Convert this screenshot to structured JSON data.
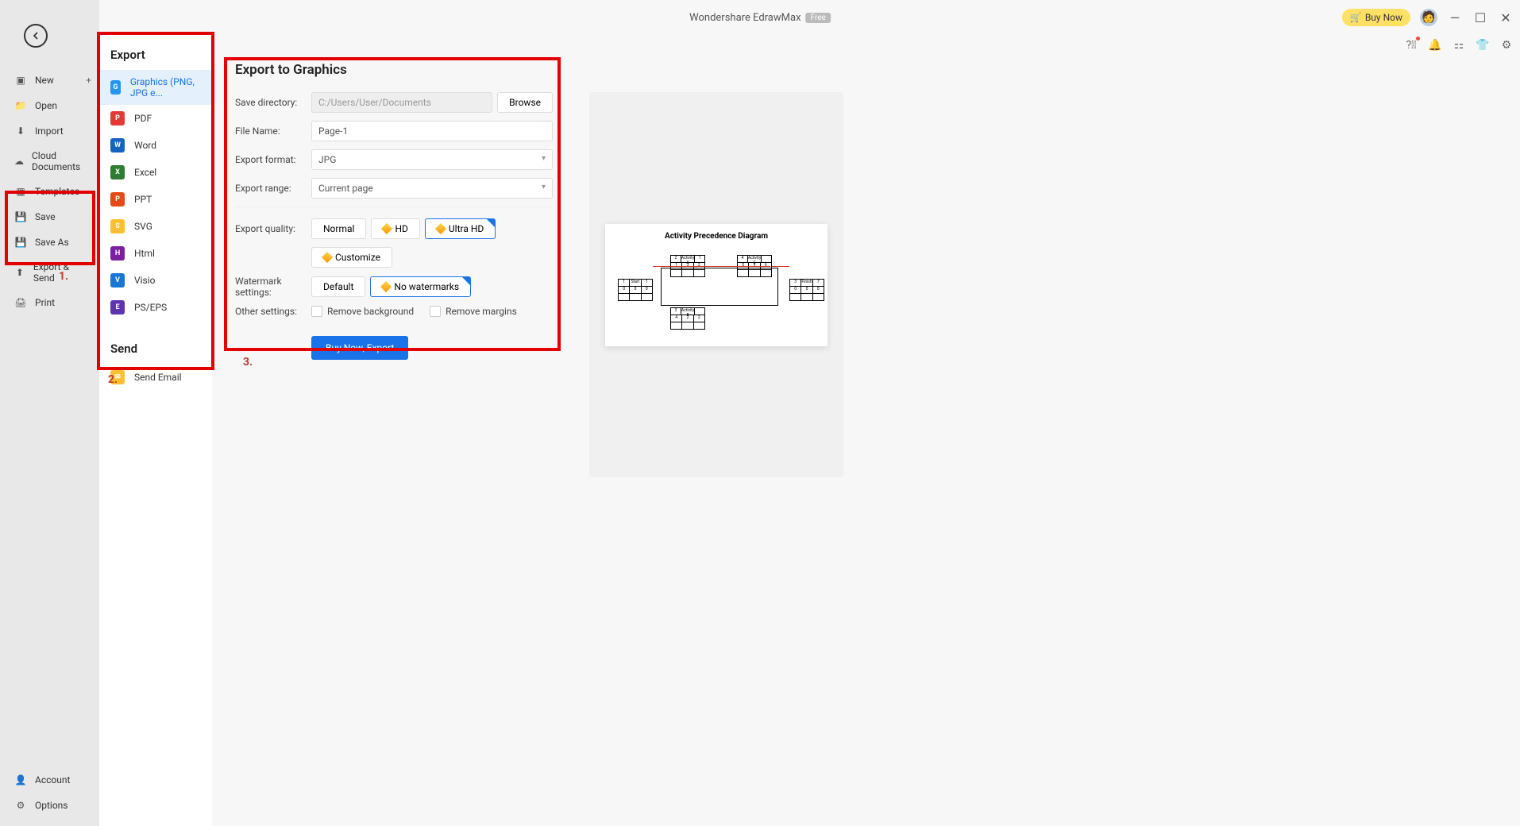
{
  "app": {
    "title": "Wondershare EdrawMax",
    "badge": "Free",
    "buy_now": "Buy Now"
  },
  "left_sidebar": {
    "items": [
      {
        "label": "New",
        "icon": "plus-box"
      },
      {
        "label": "Open",
        "icon": "folder"
      },
      {
        "label": "Import",
        "icon": "import"
      },
      {
        "label": "Cloud Documents",
        "icon": "cloud"
      },
      {
        "label": "Templates",
        "icon": "template"
      },
      {
        "label": "Save",
        "icon": "save"
      },
      {
        "label": "Save As",
        "icon": "save-as"
      },
      {
        "label": "Export & Send",
        "icon": "export"
      },
      {
        "label": "Print",
        "icon": "print"
      }
    ],
    "bottom": [
      {
        "label": "Account",
        "icon": "user"
      },
      {
        "label": "Options",
        "icon": "gear"
      }
    ]
  },
  "annotations": {
    "one": "1.",
    "two": "2.",
    "three": "3."
  },
  "export_panel": {
    "title_export": "Export",
    "title_send": "Send",
    "items": [
      {
        "label": "Graphics (PNG, JPG e...",
        "color": "#2196f3",
        "letter": "G"
      },
      {
        "label": "PDF",
        "color": "#e53935",
        "letter": "P"
      },
      {
        "label": "Word",
        "color": "#1565c0",
        "letter": "W"
      },
      {
        "label": "Excel",
        "color": "#2e7d32",
        "letter": "X"
      },
      {
        "label": "PPT",
        "color": "#e64a19",
        "letter": "P"
      },
      {
        "label": "SVG",
        "color": "#fbc02d",
        "letter": "S"
      },
      {
        "label": "Html",
        "color": "#7b1fa2",
        "letter": "H"
      },
      {
        "label": "Visio",
        "color": "#1976d2",
        "letter": "V"
      },
      {
        "label": "PS/EPS",
        "color": "#5e35b1",
        "letter": "E"
      }
    ],
    "send_items": [
      {
        "label": "Send Email",
        "color": "#fbc02d",
        "letter": "✉"
      }
    ]
  },
  "settings": {
    "title": "Export to Graphics",
    "labels": {
      "save_dir": "Save directory:",
      "file_name": "File Name:",
      "format": "Export format:",
      "range": "Export range:",
      "quality": "Export quality:",
      "watermark": "Watermark settings:",
      "other": "Other settings:"
    },
    "values": {
      "save_dir": "C:/Users/User/Documents",
      "file_name": "Page-1",
      "format": "JPG",
      "range": "Current page"
    },
    "browse": "Browse",
    "quality": {
      "normal": "Normal",
      "hd": "HD",
      "ultra": "Ultra HD",
      "custom": "Customize"
    },
    "watermark": {
      "default": "Default",
      "none": "No watermarks"
    },
    "other": {
      "remove_bg": "Remove background",
      "remove_margins": "Remove margins"
    },
    "export_btn": "Buy Now, Export"
  },
  "preview": {
    "diagram_title": "Activity Precedence Diagram"
  }
}
